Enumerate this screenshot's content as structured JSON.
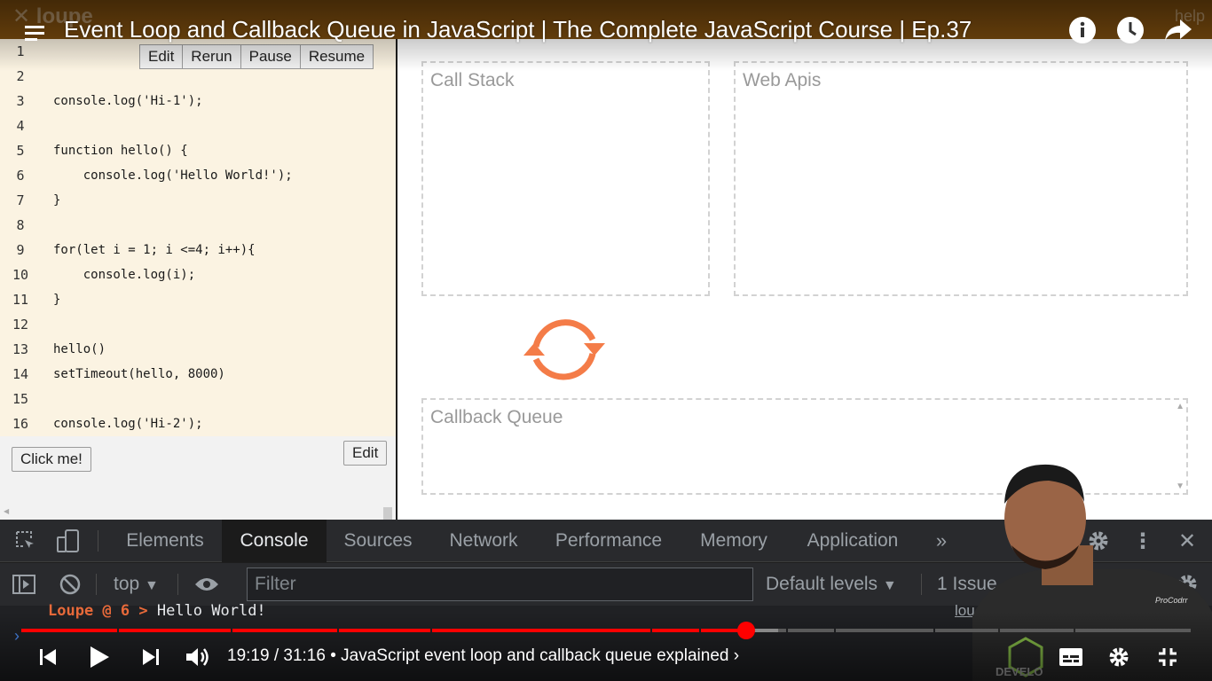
{
  "loupe": {
    "logo": "loupe",
    "help": "help"
  },
  "video": {
    "title": "Event Loop and Callback Queue in JavaScript | The Complete JavaScript Course | Ep.37",
    "time": "19:19 / 31:16",
    "chapter": "• JavaScript event loop and callback queue explained",
    "chapter_arrow": "›",
    "progress_percent": 62,
    "colors": {
      "played": "#ff0000",
      "buffered": "#888888",
      "track": "#5a5a5a"
    }
  },
  "editor": {
    "buttons": [
      "Edit",
      "Rerun",
      "Pause",
      "Resume"
    ],
    "lines": [
      {
        "n": "1",
        "code": ""
      },
      {
        "n": "2",
        "code": ""
      },
      {
        "n": "3",
        "code": "console.log('Hi-1');"
      },
      {
        "n": "4",
        "code": ""
      },
      {
        "n": "5",
        "code": "function hello() {"
      },
      {
        "n": "6",
        "code": "    console.log('Hello World!');"
      },
      {
        "n": "7",
        "code": "}"
      },
      {
        "n": "8",
        "code": ""
      },
      {
        "n": "9",
        "code": "for(let i = 1; i <=4; i++){"
      },
      {
        "n": "10",
        "code": "    console.log(i);"
      },
      {
        "n": "11",
        "code": "}"
      },
      {
        "n": "12",
        "code": ""
      },
      {
        "n": "13",
        "code": "hello()"
      },
      {
        "n": "14",
        "code": "setTimeout(hello, 8000)"
      },
      {
        "n": "15",
        "code": ""
      },
      {
        "n": "16",
        "code": "console.log('Hi-2');"
      }
    ],
    "click_me": "Click me!",
    "edit_label": "Edit"
  },
  "visualizer": {
    "call_stack": "Call Stack",
    "web_apis": "Web Apis",
    "callback_queue": "Callback Queue",
    "loop_color": "#f47c48"
  },
  "devtools": {
    "tabs": [
      "Elements",
      "Console",
      "Sources",
      "Network",
      "Performance",
      "Memory",
      "Application"
    ],
    "active_tab": "Console",
    "more": "»",
    "context": "top",
    "filter_placeholder": "Filter",
    "levels": "Default levels",
    "issues": "1 Issue",
    "log": {
      "source": "Loupe @ 6 >",
      "message": "Hello World!",
      "link": "lou"
    }
  },
  "presenter": {
    "watermark": "ProCodrr",
    "shirt_text": "DEVELO"
  }
}
